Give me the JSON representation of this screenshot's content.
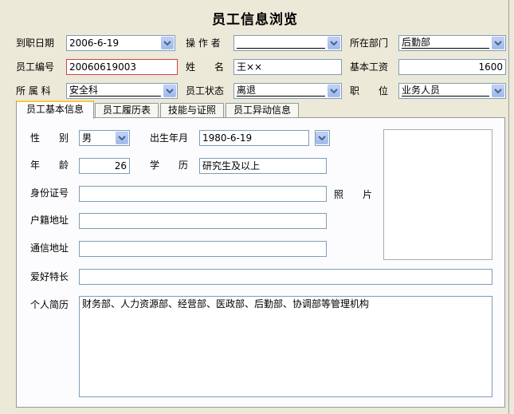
{
  "title": "员工信息浏览",
  "top": {
    "hire_date_label": "到职日期",
    "hire_date": "2006-6-19",
    "operator_label": "操 作 者",
    "operator": "",
    "dept_label": "所在部门",
    "dept": "后勤部",
    "emp_no_label": "员工编号",
    "emp_no": "20060619003",
    "name_label": "姓　　名",
    "name": "王××",
    "salary_label": "基本工资",
    "salary": "1600",
    "section_label": "所 属 科",
    "section": "安全科",
    "status_label": "员工状态",
    "status": "离退",
    "position_label": "职　　位",
    "position": "业务人员"
  },
  "tabs": [
    "员工基本信息",
    "员工履历表",
    "技能与证照",
    "员工异动信息"
  ],
  "basic": {
    "gender_label": "性　　别",
    "gender": "男",
    "birth_label": "出生年月",
    "birth": "1980-6-19",
    "age_label": "年　　龄",
    "age": "26",
    "edu_label": "学　　历",
    "edu": "研究生及以上",
    "id_label": "身份证号",
    "id": "",
    "photo_label": "照　　片",
    "huji_label": "户籍地址",
    "huji": "",
    "addr_label": "通信地址",
    "addr": "",
    "hobby_label": "爱好特长",
    "hobby": "",
    "resume_label": "个人简历",
    "resume": "财务部、人力资源部、经营部、医政部、后勤部、协调部等管理机构"
  },
  "icons": {
    "dropdown": "chevron-down-icon"
  }
}
